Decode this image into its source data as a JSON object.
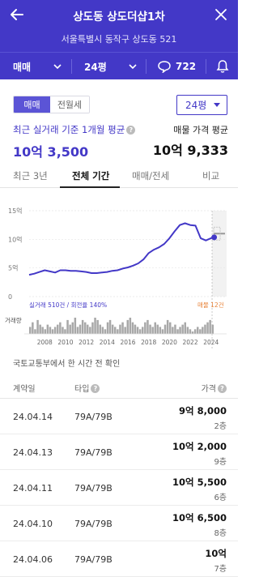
{
  "header": {
    "title": "상도동 상도더샵1차",
    "address": "서울특별시 동작구 상도동 521",
    "trade_type": "매매",
    "area": "24평",
    "comment_count": "722",
    "bg_color": "#4338c7"
  },
  "filter": {
    "toggle_active": "매매",
    "toggle_inactive": "전월세",
    "area_dropdown": "24평"
  },
  "summary": {
    "left_label": "최근 실거래 기준 1개월 평균",
    "left_value": "10억 3,500",
    "right_label": "매물 가격 평균",
    "right_value": "10억 9,333"
  },
  "tabs": [
    {
      "label": "최근 3년"
    },
    {
      "label": "전체 기간"
    },
    {
      "label": "매매/전세"
    },
    {
      "label": "비교"
    }
  ],
  "chart_data": {
    "type": "line",
    "x": [
      2006.5,
      2007,
      2007.5,
      2008,
      2008.5,
      2009,
      2009.5,
      2010,
      2010.5,
      2011,
      2011.5,
      2012,
      2012.5,
      2013,
      2013.5,
      2014,
      2014.5,
      2015,
      2015.5,
      2016,
      2016.5,
      2017,
      2017.5,
      2018,
      2018.5,
      2019,
      2019.5,
      2020,
      2020.5,
      2021,
      2021.5,
      2022,
      2022.5,
      2023,
      2023.5,
      2024,
      2024.3
    ],
    "values": [
      3.8,
      4.0,
      4.3,
      4.6,
      4.4,
      4.2,
      4.6,
      4.6,
      4.5,
      4.5,
      4.4,
      4.3,
      4.1,
      4.1,
      4.2,
      4.3,
      4.5,
      4.6,
      4.9,
      5.1,
      5.4,
      5.8,
      6.5,
      7.6,
      8.2,
      8.6,
      9.2,
      10.2,
      11.4,
      12.5,
      12.8,
      12.5,
      12.4,
      10.2,
      9.8,
      10.2,
      10.35
    ],
    "y_ticks": [
      "15억",
      "10억",
      "5억",
      "0"
    ],
    "ylim": [
      0,
      15
    ],
    "xlim": [
      2006.5,
      2025.5
    ],
    "x_ticks": [
      "2008",
      "2010",
      "2012",
      "2014",
      "2016",
      "2018",
      "2020",
      "2022",
      "2024"
    ],
    "listing_value": 11,
    "series_legend": "실거래 510건 / 회전율 140%",
    "listing_legend": "매물 12건",
    "volume_label": "거래량",
    "line_color": "#4338c7",
    "listing_color": "#999999",
    "volume": [
      3,
      5,
      2,
      6,
      4,
      3,
      2,
      4,
      3,
      2,
      3,
      4,
      5,
      3,
      2,
      6,
      4,
      5,
      7,
      3,
      4,
      6,
      5,
      4,
      3,
      5,
      7,
      6,
      4,
      3,
      2,
      5,
      6,
      4,
      3,
      2,
      4,
      5,
      3,
      6,
      7,
      5,
      4,
      3,
      2,
      3,
      5,
      6,
      4,
      3,
      5,
      4,
      3,
      2,
      4,
      6,
      5,
      3,
      4,
      2,
      3,
      4,
      5,
      3,
      2,
      1,
      2,
      3,
      2,
      3,
      4,
      5,
      6,
      4
    ]
  },
  "table": {
    "source_note": "국토교통부에서 한 시간 전 확인",
    "headers": [
      "계약일",
      "타입",
      "가격"
    ],
    "rows": [
      {
        "date": "24.04.14",
        "type": "79A/79B",
        "price": "9억 8,000",
        "floor": "2층"
      },
      {
        "date": "24.04.13",
        "type": "79A/79B",
        "price": "10억 2,000",
        "floor": "9층"
      },
      {
        "date": "24.04.11",
        "type": "79A/79B",
        "price": "10억 5,500",
        "floor": "6층"
      },
      {
        "date": "24.04.10",
        "type": "79A/79B",
        "price": "10억 6,500",
        "floor": "8층"
      },
      {
        "date": "24.04.06",
        "type": "79A/79B",
        "price": "10억",
        "floor": "7층"
      }
    ]
  }
}
